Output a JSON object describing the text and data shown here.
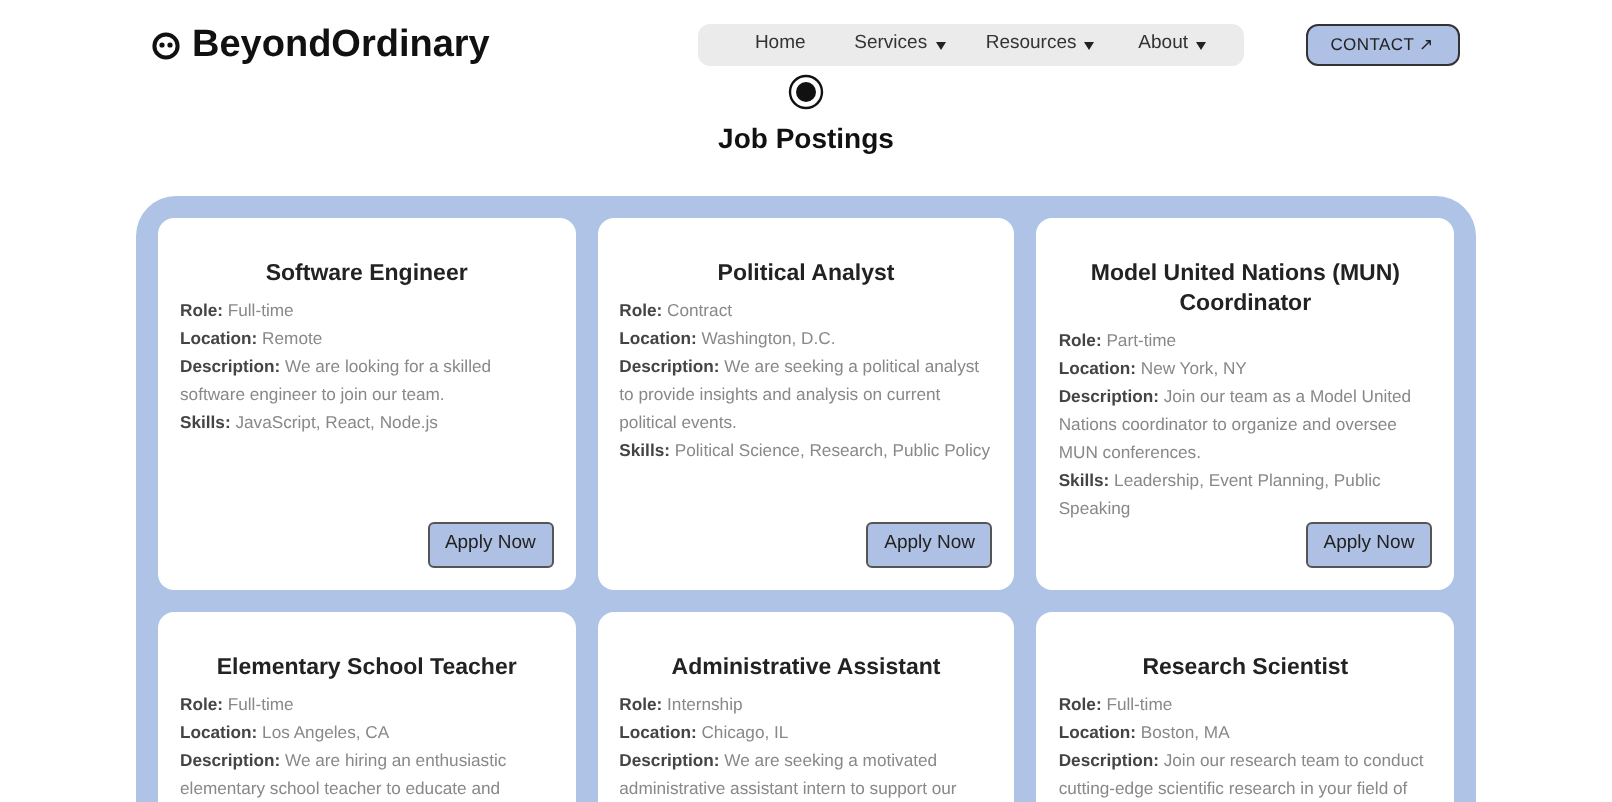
{
  "header": {
    "logo": "BeyondOrdinary",
    "nav": [
      {
        "label": "Home",
        "dropdown": false
      },
      {
        "label": "Services",
        "dropdown": true
      },
      {
        "label": "Resources",
        "dropdown": true
      },
      {
        "label": "About",
        "dropdown": true
      }
    ],
    "contact": "CONTACT ↗"
  },
  "title": "Job Postings",
  "jobs": [
    {
      "title": "Software Engineer",
      "fields": [
        {
          "label": "Role:",
          "value": "Full-time"
        },
        {
          "label": "Location:",
          "value": "Remote"
        },
        {
          "label": "Description:",
          "value": "We are looking for a skilled software engineer to join our team."
        },
        {
          "label": "Skills:",
          "value": "JavaScript, React, Node.js"
        }
      ],
      "button": "Apply Now"
    },
    {
      "title": "Political Analyst",
      "fields": [
        {
          "label": "Role:",
          "value": "Contract"
        },
        {
          "label": "Location:",
          "value": "Washington, D.C."
        },
        {
          "label": "Description:",
          "value": "We are seeking a political analyst to provide insights and analysis on current political events."
        },
        {
          "label": "Skills:",
          "value": "Political Science, Research, Public Policy"
        }
      ],
      "button": "Apply Now"
    },
    {
      "title": "Model United Nations (MUN) Coordinator",
      "fields": [
        {
          "label": "Role:",
          "value": "Part-time"
        },
        {
          "label": "Location:",
          "value": "New York, NY"
        },
        {
          "label": "Description:",
          "value": "Join our team as a Model United Nations coordinator to organize and oversee MUN conferences."
        },
        {
          "label": "Skills:",
          "value": "Leadership, Event Planning, Public Speaking"
        }
      ],
      "button": "Apply Now"
    },
    {
      "title": "Elementary School Teacher",
      "fields": [
        {
          "label": "Role:",
          "value": "Full-time"
        },
        {
          "label": "Location:",
          "value": "Los Angeles, CA"
        },
        {
          "label": "Description:",
          "value": "We are hiring an enthusiastic elementary school teacher to educate and"
        }
      ]
    },
    {
      "title": "Administrative Assistant",
      "fields": [
        {
          "label": "Role:",
          "value": "Internship"
        },
        {
          "label": "Location:",
          "value": "Chicago, IL"
        },
        {
          "label": "Description:",
          "value": "We are seeking a motivated administrative assistant intern to support our"
        }
      ]
    },
    {
      "title": "Research Scientist",
      "fields": [
        {
          "label": "Role:",
          "value": "Full-time"
        },
        {
          "label": "Location:",
          "value": "Boston, MA"
        },
        {
          "label": "Description:",
          "value": "Join our research team to conduct cutting-edge scientific research in your field of"
        }
      ]
    }
  ]
}
